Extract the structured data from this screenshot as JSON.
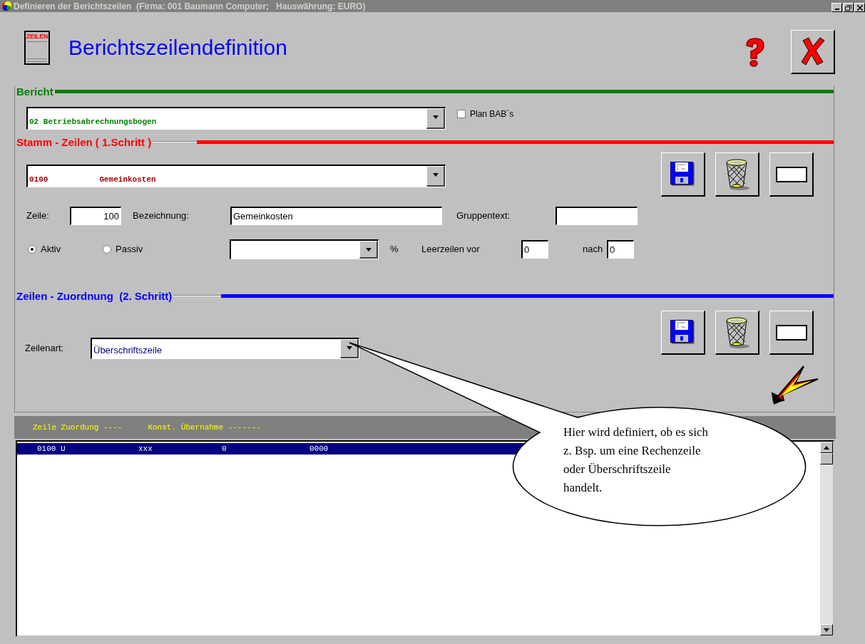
{
  "window": {
    "title": "Definieren der Berichtszeilen  (Firma: 001 Baumann Computer;   Hauswährung: EURO)"
  },
  "header": {
    "logo_text": "ZEILEN",
    "title": "Berichtszeilendefinition"
  },
  "bericht": {
    "title": "Bericht",
    "report": "02 Betriebsabrechnungsbogen",
    "plan_checkbox": {
      "label": "Plan BAB´s",
      "checked": false
    }
  },
  "stamm": {
    "title": "Stamm - Zeilen ( 1.Schritt )",
    "line_select": [
      "0100",
      "Gemeinkosten"
    ],
    "zeile_label": "Zeile:",
    "zeile": "100",
    "bezeichnung_label": "Bezeichnung:",
    "bezeichnung": "Gemeinkosten",
    "gruppentext_label": "Gruppentext:",
    "radios": [
      {
        "label": "Aktiv",
        "selected": true
      },
      {
        "label": "Passiv",
        "selected": false
      }
    ],
    "percent": "%",
    "leer_label": "Leerzeilen vor",
    "leer_vor": "0",
    "nach_label": "nach",
    "leer_nach": "0"
  },
  "zuordnung": {
    "title": "Zeilen - Zuordnung  (2. Schritt)",
    "zeilenart_label": "Zeilenart:",
    "zeilenart": "Überschriftszeile"
  },
  "list": {
    "header": [
      "Zeile Zuordung ----",
      "Konst. Übernahme -------"
    ],
    "rows": [
      {
        "cells": [
          "0100 U",
          "xxx",
          "0",
          "0000"
        ],
        "selected": true
      }
    ]
  },
  "callout": {
    "lines": [
      "Hier wird definiert, ob es sich",
      "z. Bsp. um eine Rechenzeile",
      "oder Überschriftszeile",
      "handelt."
    ]
  }
}
